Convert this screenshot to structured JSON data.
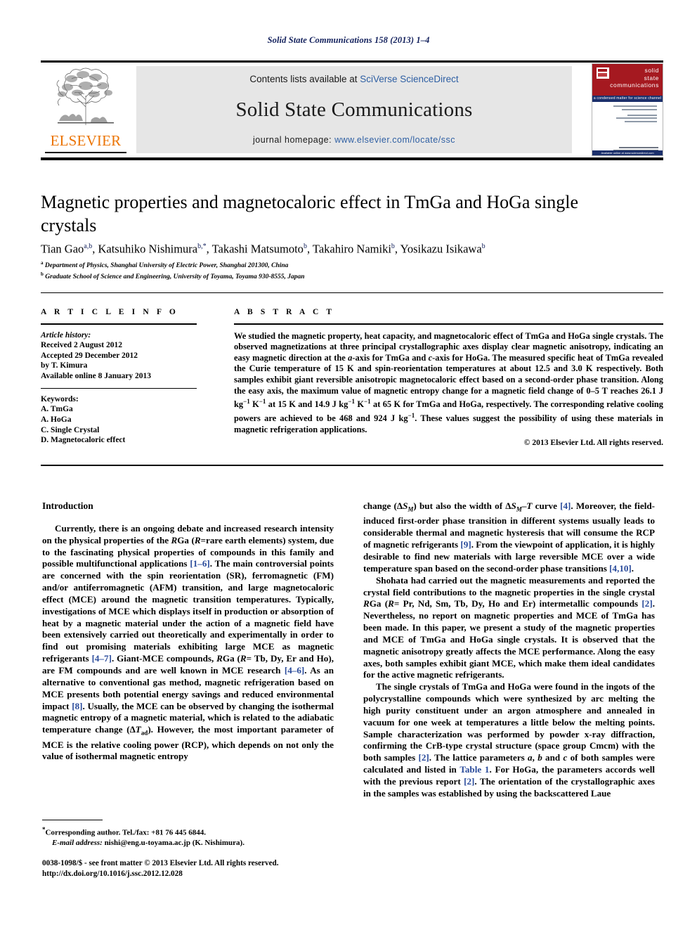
{
  "running_head": "Solid State Communications 158 (2013) 1–4",
  "masthead": {
    "contents_prefix": "Contents lists available at ",
    "contents_link": "SciVerse ScienceDirect",
    "journal_name": "Solid State Communications",
    "homepage_prefix": "journal homepage: ",
    "homepage_link": "www.elsevier.com/locate/ssc",
    "publisher_wordmark": "ELSEVIER",
    "cover": {
      "title_line1": "solid",
      "title_line2": "state",
      "title_line3": "communications",
      "subtitle": "a condensed matter for science channel",
      "footer_bar": "Available online at www.sciencedirect.com"
    },
    "accent_colors": {
      "link_blue": "#2e5fa3",
      "elsevier_orange": "#eb7404",
      "cover_red": "#a51920",
      "cover_blue": "#1b2f6b",
      "band_grey": "#e6e6e6"
    }
  },
  "article": {
    "title": "Magnetic properties and magnetocaloric effect in TmGa and HoGa single crystals",
    "authors": [
      {
        "name": "Tian Gao",
        "marks": "a,b"
      },
      {
        "name": "Katsuhiko Nishimura",
        "marks": "b,*"
      },
      {
        "name": "Takashi Matsumoto",
        "marks": "b"
      },
      {
        "name": "Takahiro Namiki",
        "marks": "b"
      },
      {
        "name": "Yosikazu Isikawa",
        "marks": "b"
      }
    ],
    "affiliations": [
      {
        "mark": "a",
        "text": "Department of Physics, Shanghai University of Electric Power, Shanghai 201300, China"
      },
      {
        "mark": "b",
        "text": "Graduate School of Science and Engineering, University of Toyama, Toyama 930-8555, Japan"
      }
    ]
  },
  "article_info": {
    "heading": "A R T I C L E  I N F O",
    "history_label": "Article history:",
    "history": [
      "Received 2 August 2012",
      "Accepted 29 December 2012",
      "by T. Kimura",
      "Available online 8 January 2013"
    ],
    "keywords_label": "Keywords:",
    "keywords": [
      "A. TmGa",
      "A. HoGa",
      "C. Single Crystal",
      "D. Magnetocaloric effect"
    ]
  },
  "abstract": {
    "heading": "A B S T R A C T",
    "paragraph_1": "We studied the magnetic property, heat capacity, and magnetocaloric effect of TmGa and HoGa single crystals. The observed magnetizations at three principal crystallographic axes display clear magnetic anisotropy, indicating an easy magnetic direction at the ",
    "a_axis": "a",
    "paragraph_2": "-axis for TmGa and ",
    "c_axis": "c",
    "paragraph_3": "-axis for HoGa. The measured specific heat of TmGa revealed the Curie temperature of 15 K and spin-reorientation temperatures at about 12.5 and 3.0 K respectively. Both samples exhibit giant reversible anisotropic magnetocaloric effect based on a second-order phase transition. Along the easy axis, the maximum value of magnetic entropy change for a magnetic field change of 0–5 T reaches 26.1 J kg",
    "unit_1": "−1",
    "paragraph_4": " K",
    "unit_2": "−1",
    "paragraph_5": " at 15 K and 14.9 J kg",
    "unit_3": "−1",
    "paragraph_6": " K",
    "unit_4": "−1",
    "paragraph_7": " at 65 K for TmGa and HoGa, respectively. The corresponding relative cooling powers are achieved to be 468 and 924 J kg",
    "unit_5": "−1",
    "paragraph_8": ". These values suggest the possibility of using these materials in magnetic refrigeration applications.",
    "copyright": "© 2013 Elsevier Ltd. All rights reserved."
  },
  "body": {
    "section_title": "Introduction",
    "left_column": {
      "p1_a": "Currently, there is an ongoing debate and increased research intensity on the physical properties of the ",
      "p1_rga": "R",
      "p1_b": "Ga (",
      "p1_r": "R",
      "p1_c": "=rare earth elements) system, due to the fascinating physical properties of compounds in this family and possible multifunctional applications ",
      "p1_ref1": "[1–6]",
      "p1_d": ". The main controversial points are concerned with the spin reorientation (SR), ferromagnetic (FM) and/or antiferromagnetic (AFM) transition, and large magnetocaloric effect (MCE) around the magnetic transition temperatures. Typically, investigations of MCE which displays itself in production or absorption of heat by a magnetic material under the action of a magnetic field have been extensively carried out theoretically and experimentally in order to find out promising materials exhibiting large MCE as magnetic refrigerants ",
      "p1_ref2": "[4–7]",
      "p1_e": ". Giant-MCE compounds, ",
      "p1_rga2": "R",
      "p1_f": "Ga (",
      "p1_r2": "R",
      "p1_g": "= Tb, Dy, Er and Ho), are FM compounds and are well known in MCE research ",
      "p1_ref3": "[4–6]",
      "p1_h": ". As an alternative to conventional gas method, magnetic refrigeration based on MCE presents both potential energy savings and reduced environmental impact ",
      "p1_ref4": "[8]",
      "p1_i": ". Usually, the MCE can be observed by changing the isothermal magnetic entropy of a magnetic material, which is related to the adiabatic temperature change (Δ",
      "p1_tvar": "T",
      "p1_tsub": "ad",
      "p1_j": "). However, the most important parameter of MCE is the relative cooling power (RCP), which depends on not only the value of isothermal magnetic entropy"
    },
    "right_column": {
      "p2_a": "change (Δ",
      "p2_s1": "S",
      "p2_s1sub": "M",
      "p2_b": ") but also the width of Δ",
      "p2_s2": "S",
      "p2_s2sub": "M",
      "p2_c": "–",
      "p2_t": "T",
      "p2_d": " curve ",
      "p2_ref1": "[4]",
      "p2_e": ". Moreover, the field-induced first-order phase transition in different systems usually leads to considerable thermal and magnetic hysteresis that will consume the RCP of magnetic refrigerants ",
      "p2_ref2": "[9]",
      "p2_f": ". From the viewpoint of application, it is highly desirable to find new materials with large reversible MCE over a wide temperature span based on the second-order phase transitions ",
      "p2_ref3": "[4,10]",
      "p2_g": ".",
      "p3_a": "Shohata had carried out the magnetic measurements and reported the crystal field contributions to the magnetic properties in the single crystal ",
      "p3_rga": "R",
      "p3_b": "Ga (",
      "p3_r": "R",
      "p3_c": "= Pr, Nd, Sm, Tb, Dy, Ho and Er) intermetallic compounds ",
      "p3_ref1": "[2]",
      "p3_d": ". Nevertheless, no report on magnetic properties and MCE of TmGa has been made. In this paper, we present a study of the magnetic properties and MCE of TmGa and HoGa single crystals. It is observed that the magnetic anisotropy greatly affects the MCE performance. Along the easy axes, both samples exhibit giant MCE, which make them ideal candidates for the active magnetic refrigerants.",
      "p4_a": "The single crystals of TmGa and HoGa were found in the ingots of the polycrystalline compounds which were synthesized by arc melting the high purity constituent under an argon atmosphere and annealed in vacuum for one week at temperatures a little below the melting points. Sample characterization was performed by powder x-ray diffraction, confirming the CrB-type crystal structure (space group Cmcm) with the both samples ",
      "p4_ref1": "[2]",
      "p4_b": ". The lattice parameters ",
      "p4_a_it": "a",
      "p4_c": ", ",
      "p4_b_it": "b",
      "p4_d": " and ",
      "p4_c_it": "c",
      "p4_e": " of both samples were calculated and listed in ",
      "p4_table_link": "Table 1",
      "p4_f": ". For HoGa, the parameters accords well with the previous report ",
      "p4_ref2": "[2]",
      "p4_g": ". The orientation of the crystallographic axes in the samples was established by using the backscattered Laue"
    }
  },
  "footnote": {
    "corresponding": "Corresponding author. Tel./fax: +81 76 445 6844.",
    "email_label": "E-mail address:",
    "email": " nishi@eng.u-toyama.ac.jp (K. Nishimura)."
  },
  "imprint": {
    "line1": "0038-1098/$ - see front matter © 2013 Elsevier Ltd. All rights reserved.",
    "line2": "http://dx.doi.org/10.1016/j.ssc.2012.12.028"
  }
}
